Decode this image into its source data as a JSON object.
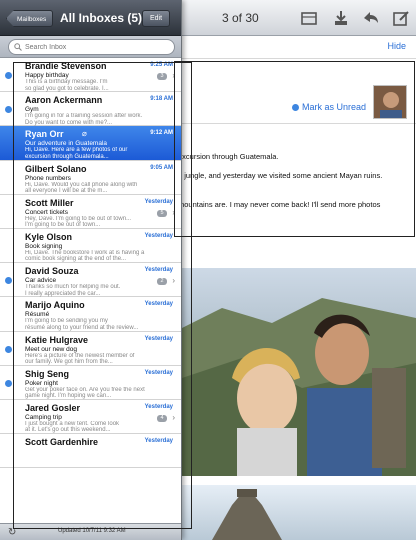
{
  "toolbar": {
    "counter": "3 of 30",
    "icons": [
      "folder-icon",
      "move-icon",
      "reply-icon",
      "compose-icon"
    ]
  },
  "message": {
    "hide_label": "Hide",
    "mark_unread_label": "Mark as Unread",
    "body_lines": [
      "excursion through Guatemala.",
      "e jungle, and yesterday we visited some ancient Mayan ruins.",
      "mountains are. I may never come back! I'll send more photos"
    ]
  },
  "inbox": {
    "back_label": "Mailboxes",
    "title": "All Inboxes (5)",
    "edit_label": "Edit",
    "search_placeholder": "Search Inbox",
    "messages": [
      {
        "sender": "Brandie Stevenson",
        "time": "9:25 AM",
        "subject": "Happy birthday",
        "preview": [
          "This is a birthday message. I'm",
          "so glad you got to celebrate. I..."
        ],
        "unread": true,
        "count": "3"
      },
      {
        "sender": "Aaron Ackermann",
        "time": "9:18 AM",
        "subject": "Gym",
        "preview": [
          "I'm going in for a training session after work.",
          "Do you want to come with me?..."
        ],
        "unread": true
      },
      {
        "sender": "Ryan Orr",
        "time": "9:12 AM",
        "subject": "Our adventure in Guatemala",
        "preview": [
          "Hi, Dave. Here are a few photos of our",
          "excursion through Guatemala..."
        ],
        "unread": false,
        "selected": true,
        "attachment": "paperclip-icon"
      },
      {
        "sender": "Gilbert Solano",
        "time": "9:05 AM",
        "subject": "Phone numbers",
        "preview": [
          "Hi, Dave. Would you call phone along with",
          "all everyone I will be at the m..."
        ],
        "unread": false
      },
      {
        "sender": "Scott Miller",
        "time": "Yesterday",
        "subject": "Concert tickets",
        "preview": [
          "Hey, Dave. I'm going to be out of town...",
          "I'm going to be out of town..."
        ],
        "unread": false,
        "count": "5"
      },
      {
        "sender": "Kyle Olson",
        "time": "Yesterday",
        "subject": "Book signing",
        "preview": [
          "Hi, Dave. The bookstore I work at is having a",
          "comic book signing at the end of the..."
        ],
        "unread": false
      },
      {
        "sender": "David Souza",
        "time": "Yesterday",
        "subject": "Car advice",
        "preview": [
          "Thanks so much for helping me out.",
          "I really appreciated the car..."
        ],
        "unread": true,
        "count": "2"
      },
      {
        "sender": "Marijo Aquino",
        "time": "Yesterday",
        "subject": "Résumé",
        "preview": [
          "I'm going to be sending you my",
          "résumé along to your friend at the review..."
        ],
        "unread": false
      },
      {
        "sender": "Katie Hulgrave",
        "time": "Yesterday",
        "subject": "Meet our new dog",
        "preview": [
          "Here's a picture of the newest member of",
          "our family. We got him from the..."
        ],
        "unread": true
      },
      {
        "sender": "Shig Seng",
        "time": "Yesterday",
        "subject": "Poker night",
        "preview": [
          "Get your poker face on. Are you free the next",
          "game night. I'm hoping we can..."
        ],
        "unread": true
      },
      {
        "sender": "Jared Gosler",
        "time": "Yesterday",
        "subject": "Camping trip",
        "preview": [
          "I just bought a new tent. Come look",
          "at it. Let's go out this weekend..."
        ],
        "unread": false,
        "count": "4"
      },
      {
        "sender": "Scott Gardenhire",
        "time": "Yesterday",
        "subject": "",
        "preview": [
          "",
          ""
        ],
        "unread": false
      }
    ],
    "updated_label": "Updated 10/7/11 9:32 AM"
  }
}
